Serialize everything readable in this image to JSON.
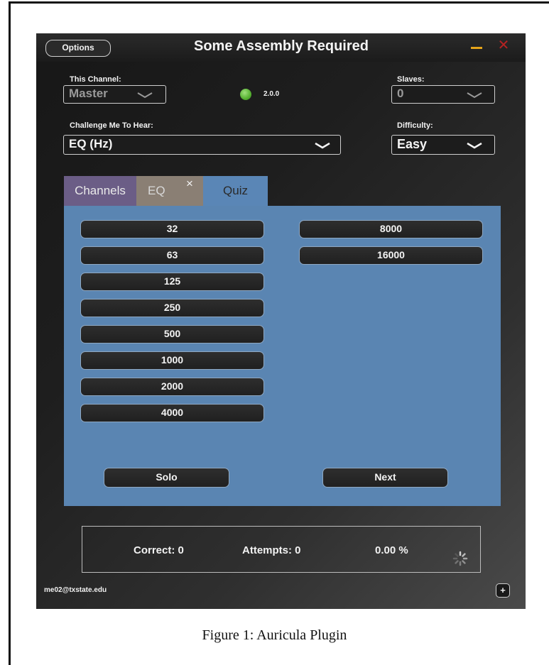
{
  "window": {
    "title": "Some Assembly Required",
    "options_label": "Options",
    "minimize_icon": "minimize-icon",
    "close_icon": "close-icon"
  },
  "controls": {
    "channel_label": "This Channel:",
    "channel_value": "Master",
    "slaves_label": "Slaves:",
    "slaves_value": "0",
    "challenge_label": "Challenge Me To Hear:",
    "challenge_value": "EQ (Hz)",
    "difficulty_label": "Difficulty:",
    "difficulty_value": "Easy",
    "status_led_color": "#55b030",
    "version": "2.0.0"
  },
  "tabs": [
    {
      "label": "Channels",
      "color": "#6b5d86"
    },
    {
      "label": "EQ",
      "color": "#8a7f74",
      "close": "×"
    },
    {
      "label": "Quiz",
      "color": "#5a86b6",
      "active": true
    }
  ],
  "quiz": {
    "panel_color": "#5a85b2",
    "frequencies_left": [
      "32",
      "63",
      "125",
      "250",
      "500",
      "1000",
      "2000",
      "4000"
    ],
    "frequencies_right": [
      "8000",
      "16000"
    ],
    "solo_label": "Solo",
    "next_label": "Next"
  },
  "score": {
    "correct": "Correct: 0",
    "attempts": "Attempts: 0",
    "percent": "0.00 %"
  },
  "footer": {
    "email": "me02@txstate.edu",
    "plus_label": "+"
  },
  "caption": "Figure 1: Auricula Plugin"
}
